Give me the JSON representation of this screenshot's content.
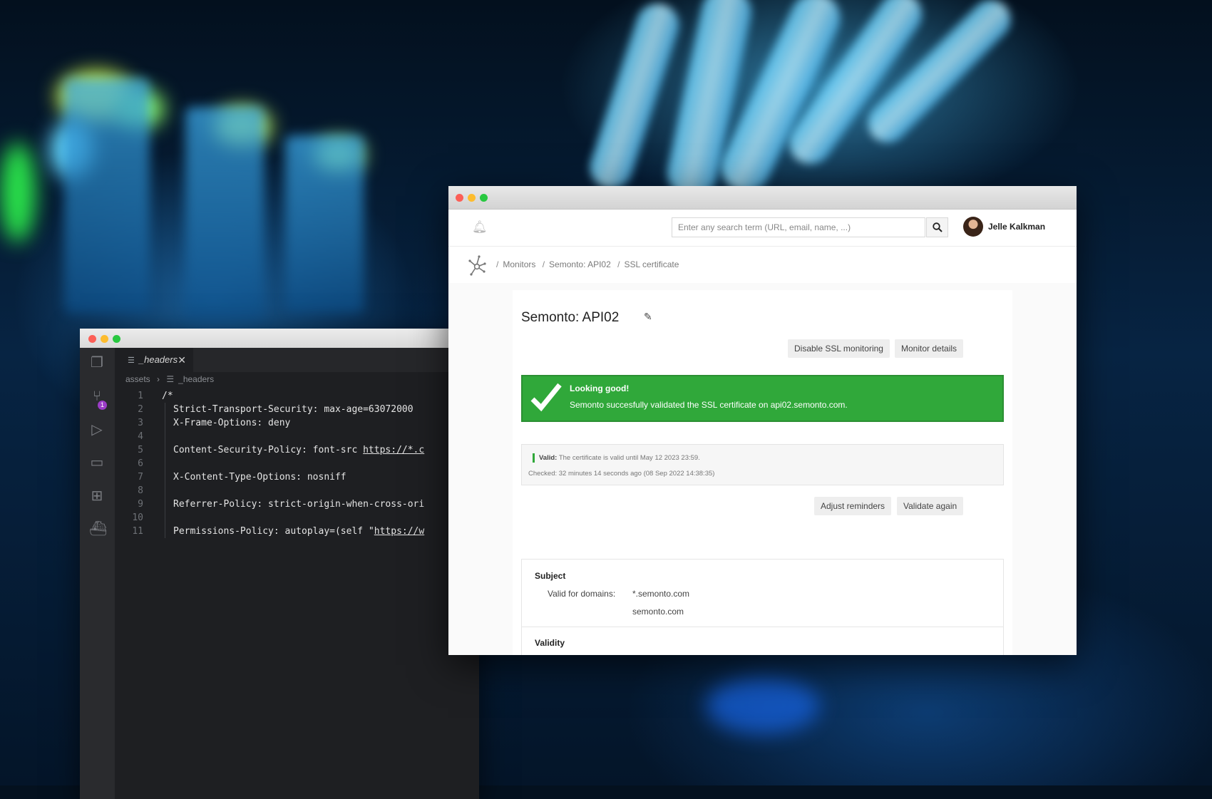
{
  "editor": {
    "tab_label": "_headers",
    "breadcrumb": [
      "assets",
      "_headers"
    ],
    "scm_badge": "1",
    "lines": [
      {
        "n": "1",
        "text": "/*",
        "indent": false
      },
      {
        "n": "2",
        "text": "Strict-Transport-Security: max-age=63072000",
        "indent": true
      },
      {
        "n": "3",
        "text": "X-Frame-Options: deny",
        "indent": true
      },
      {
        "n": "4",
        "text": "",
        "indent": true
      },
      {
        "n": "5",
        "text": "Content-Security-Policy: font-src ",
        "url": "https://*.c",
        "indent": true
      },
      {
        "n": "6",
        "text": "",
        "indent": true
      },
      {
        "n": "7",
        "text": "X-Content-Type-Options: nosniff",
        "indent": true
      },
      {
        "n": "8",
        "text": "",
        "indent": true
      },
      {
        "n": "9",
        "text": "Referrer-Policy: strict-origin-when-cross-ori",
        "indent": true
      },
      {
        "n": "10",
        "text": "",
        "indent": true
      },
      {
        "n": "11",
        "text": "Permissions-Policy: autoplay=(self \"",
        "url": "https://w",
        "indent": true
      }
    ]
  },
  "browser": {
    "search_placeholder": "Enter any search term (URL, email, name, ...)",
    "user_name": "Jelle Kalkman",
    "breadcrumb": [
      "Monitors",
      "Semonto: API02",
      "SSL certificate"
    ],
    "monitor_title": "Semonto: API02",
    "buttons": {
      "disable_ssl": "Disable SSL monitoring",
      "monitor_details": "Monitor details",
      "adjust_reminders": "Adjust reminders",
      "validate_again": "Validate again"
    },
    "alert": {
      "heading": "Looking good!",
      "message": "Semonto succesfully validated the SSL certificate on api02.semonto.com."
    },
    "status": {
      "valid_label": "Valid:",
      "valid_text": "The certificate is valid until May 12 2023 23:59.",
      "checked": "Checked: 32 minutes 14 seconds ago (08 Sep 2022 14:38:35)"
    },
    "subject": {
      "heading": "Subject",
      "domains_label": "Valid for domains:",
      "domains": [
        "*.semonto.com",
        "semonto.com"
      ],
      "validity_heading": "Validity"
    },
    "colors": {
      "success": "#30a83a"
    }
  }
}
